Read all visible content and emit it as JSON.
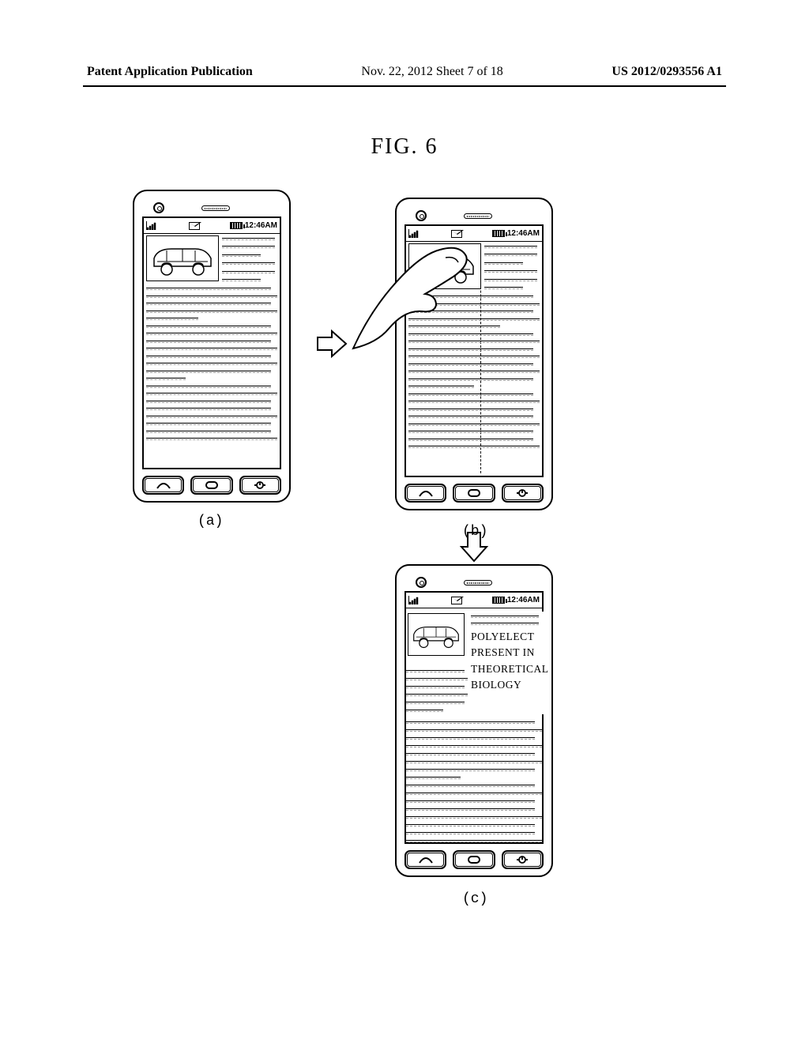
{
  "header": {
    "left": "Patent Application Publication",
    "center": "Nov. 22, 2012  Sheet 7 of 18",
    "right": "US 2012/0293556 A1"
  },
  "figure_label": "FIG. 6",
  "status": {
    "time": "12:46AM",
    "battery_label": "",
    "icons": {
      "signal": "signal-icon",
      "mail": "mail-icon",
      "battery": "battery-icon"
    }
  },
  "captions": {
    "a": "(a)",
    "b": "(b)",
    "c": "(c)"
  },
  "panel_c_text": {
    "l1": "POLYELECT",
    "l2": "PRESENT IN",
    "l3": "THEORETICAL",
    "l4": "BIOLOGY"
  }
}
